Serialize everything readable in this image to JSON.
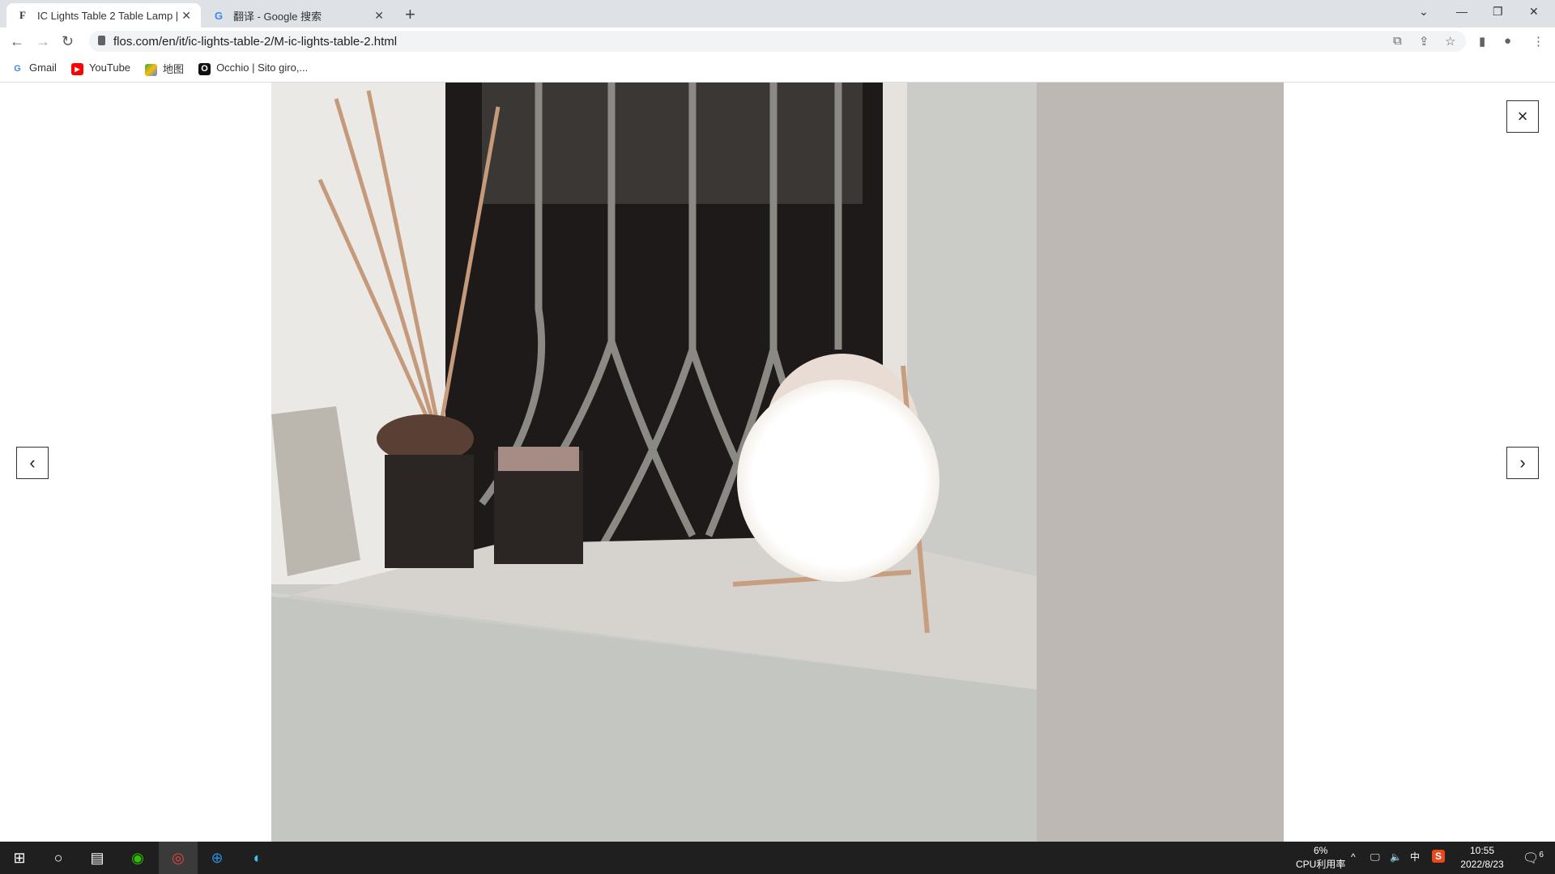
{
  "browser": {
    "tabs": [
      {
        "icon": "flos-icon",
        "label": "IC Lights Table 2 Table Lamp | F",
        "active": true
      },
      {
        "icon": "google-icon",
        "label": "翻译 - Google 搜索",
        "active": false
      }
    ],
    "url": "flos.com/en/it/ic-lights-table-2/M-ic-lights-table-2.html",
    "bookmarks": [
      {
        "icon": "google-icon",
        "label": "Gmail"
      },
      {
        "icon": "youtube-icon",
        "label": "YouTube"
      },
      {
        "icon": "maps-icon",
        "label": "地图"
      },
      {
        "icon": "occhio-icon",
        "label": "Occhio | Sito giro,..."
      }
    ]
  },
  "lightbox": {
    "close": "×",
    "prev": "‹",
    "next": "›"
  },
  "taskbar": {
    "cpu_percent": "6%",
    "cpu_label": "CPU利用率",
    "ime": "中",
    "time": "10:55",
    "date": "2022/8/23",
    "notifications": "6"
  }
}
